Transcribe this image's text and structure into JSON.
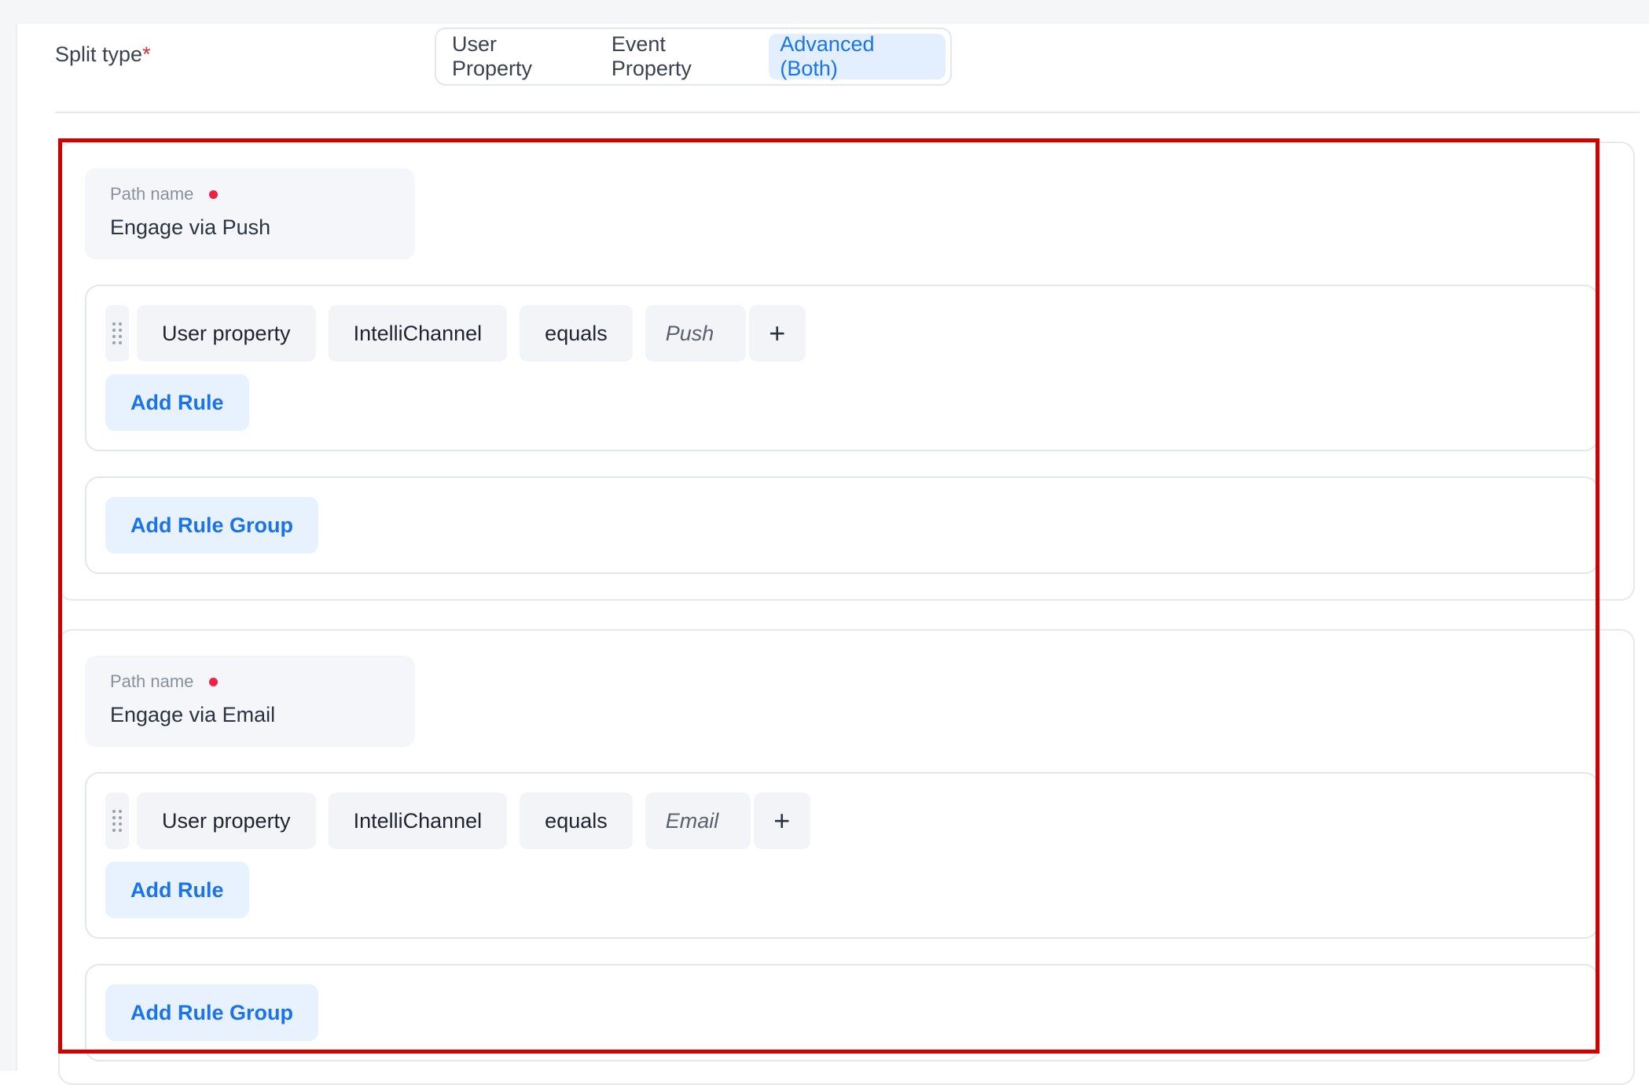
{
  "split_type": {
    "label": "Split type",
    "required_mark": "*",
    "options": [
      {
        "label": "User Property",
        "active": false
      },
      {
        "label": "Event Property",
        "active": false
      },
      {
        "label": "Advanced (Both)",
        "active": true
      }
    ]
  },
  "paths": [
    {
      "name_label": "Path name",
      "name_value": "Engage via Push",
      "rule": {
        "property_type": "User property",
        "property": "IntelliChannel",
        "operator": "equals",
        "value": "Push",
        "add_value_icon": "+"
      },
      "add_rule_label": "Add Rule",
      "add_rule_group_label": "Add Rule Group"
    },
    {
      "name_label": "Path name",
      "name_value": "Engage via Email",
      "rule": {
        "property_type": "User property",
        "property": "IntelliChannel",
        "operator": "equals",
        "value": "Email",
        "add_value_icon": "+"
      },
      "add_rule_label": "Add Rule",
      "add_rule_group_label": "Add Rule Group"
    }
  ],
  "colors": {
    "accent": "#1a73e8",
    "highlight": "#d40000",
    "required": "#ee2244"
  }
}
